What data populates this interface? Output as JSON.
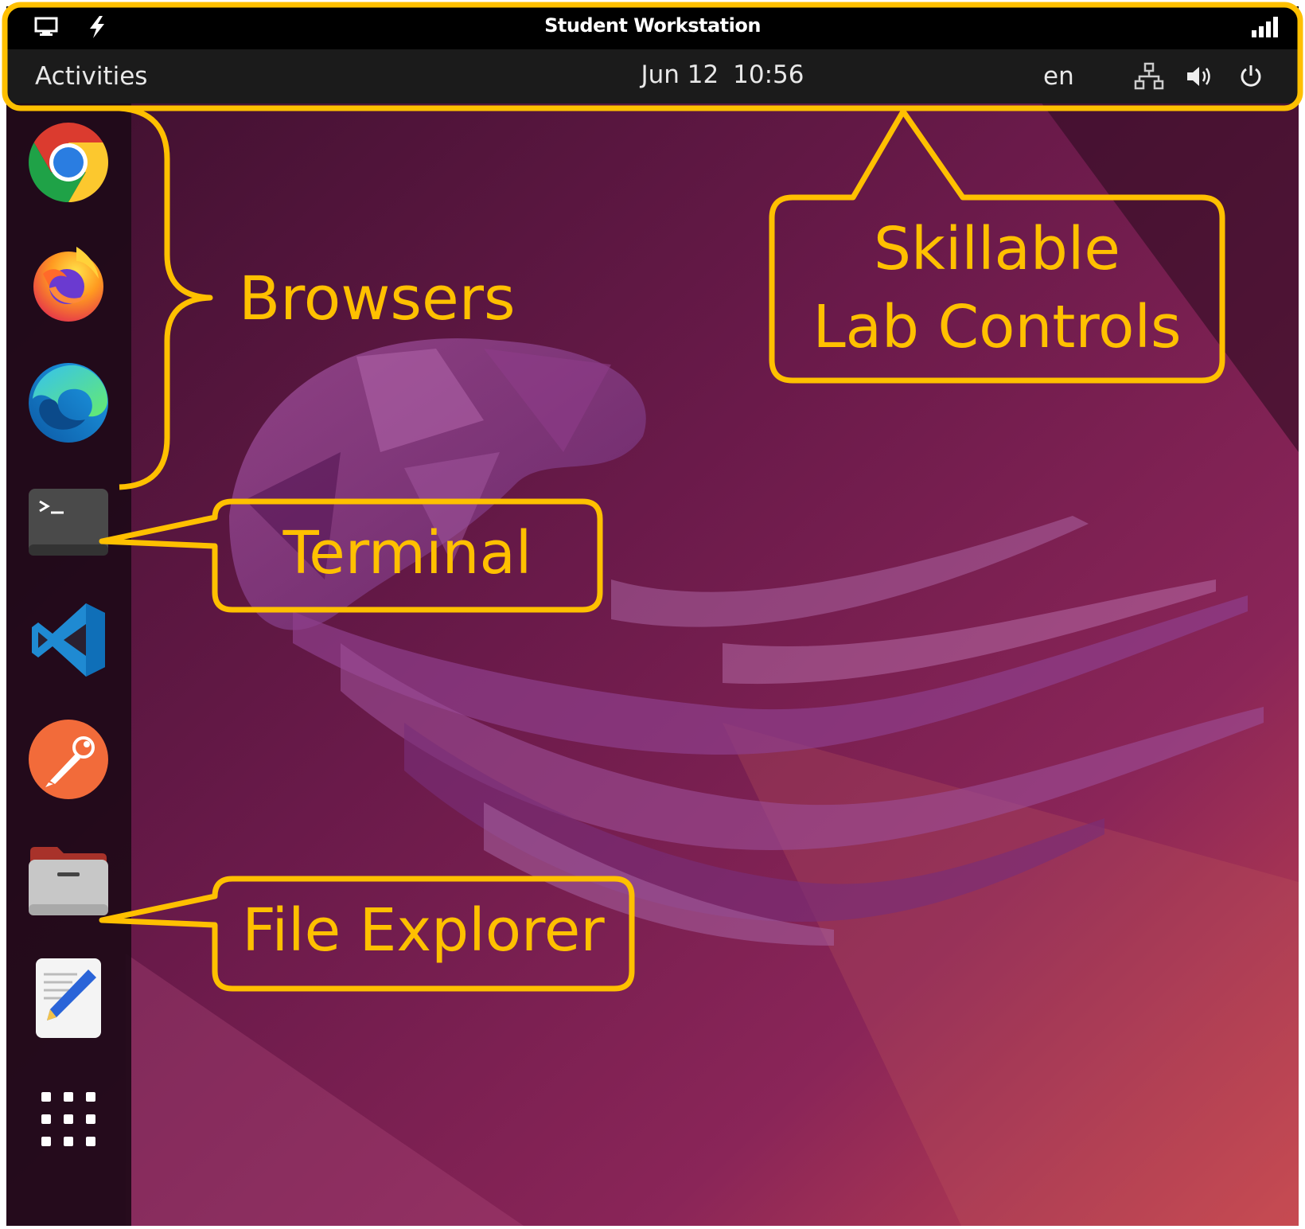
{
  "skillable_bar": {
    "title": "Student Workstation",
    "buttons": [
      {
        "icon": "monitor-icon"
      },
      {
        "icon": "lightning-icon"
      },
      {
        "icon": "signal-strength-icon"
      }
    ]
  },
  "top_bar": {
    "activities_label": "Activities",
    "clock": {
      "date": "Jun 12",
      "time": "10:56"
    },
    "language": "en",
    "tray": [
      {
        "icon": "network-icon"
      },
      {
        "icon": "volume-icon"
      },
      {
        "icon": "power-icon"
      }
    ]
  },
  "dock": {
    "items": [
      {
        "name": "Google Chrome",
        "icon": "chrome-icon"
      },
      {
        "name": "Firefox",
        "icon": "firefox-icon"
      },
      {
        "name": "Microsoft Edge",
        "icon": "edge-icon"
      },
      {
        "name": "Terminal",
        "icon": "terminal-icon"
      },
      {
        "name": "Visual Studio Code",
        "icon": "vscode-icon"
      },
      {
        "name": "Postman",
        "icon": "postman-icon"
      },
      {
        "name": "Files",
        "icon": "folder-icon"
      },
      {
        "name": "Text Editor",
        "icon": "text-editor-icon"
      },
      {
        "name": "Show Applications",
        "icon": "app-grid-icon"
      }
    ]
  },
  "annotations": {
    "browsers": "Browsers",
    "lab_controls_line1": "Skillable",
    "lab_controls_line2": "Lab Controls",
    "terminal": "Terminal",
    "file_explorer": "File Explorer"
  },
  "colors": {
    "annotation": "#ffc000",
    "wallpaper_dark": "#4a1232",
    "wallpaper_light": "#c0405a"
  }
}
